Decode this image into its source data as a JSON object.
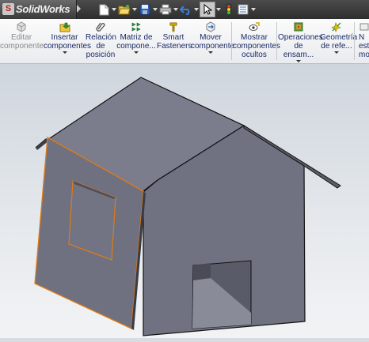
{
  "app": {
    "logo_mark": "S",
    "title": "SolidWorks"
  },
  "quick_access": {
    "icons": [
      "new-document-icon",
      "open-folder-icon",
      "save-icon",
      "print-icon",
      "undo-icon",
      "select-pointer-icon",
      "traffic-light-icon",
      "options-list-icon"
    ]
  },
  "command_manager": {
    "items": [
      {
        "id": "editar-componente",
        "label": "Editar\ncomponente",
        "enabled": false,
        "dropdown": false
      },
      {
        "id": "insertar-componentes",
        "label": "Insertar\ncomponentes",
        "enabled": true,
        "dropdown": true
      },
      {
        "id": "relacion-posicion",
        "label": "Relación\nde\nposición",
        "enabled": true,
        "dropdown": false
      },
      {
        "id": "matriz-componentes",
        "label": "Matriz de\ncompone...",
        "enabled": true,
        "dropdown": true
      },
      {
        "id": "smart-fasteners",
        "label": "Smart\nFasteners",
        "enabled": true,
        "dropdown": false
      },
      {
        "id": "mover-componente",
        "label": "Mover\ncomponente",
        "enabled": true,
        "dropdown": true
      },
      {
        "id": "mostrar-componentes-ocultos",
        "label": "Mostrar\ncomponentes\nocultos",
        "enabled": true,
        "dropdown": false
      },
      {
        "id": "operaciones-ensamblaje",
        "label": "Operaciones\nde ensam...",
        "enabled": true,
        "dropdown": true
      },
      {
        "id": "geometria-referencia",
        "label": "Geometría\nde refe...",
        "enabled": true,
        "dropdown": true
      },
      {
        "id": "nuevo-estudio",
        "label": "N\nest\nmo",
        "enabled": true,
        "dropdown": false
      }
    ]
  },
  "colors": {
    "model_face": "#6e7080",
    "model_side": "#7a7c8c",
    "model_roof": "#727484",
    "selection_edge": "#e07b12",
    "viewport_top": "#cfd5dd",
    "viewport_bottom": "#f2f3f5"
  }
}
